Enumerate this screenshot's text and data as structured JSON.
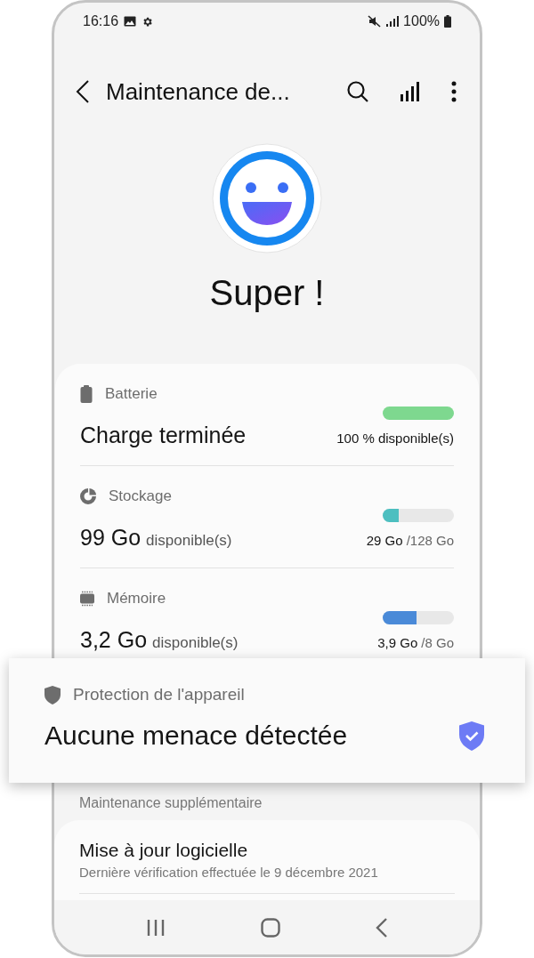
{
  "status_bar": {
    "time": "16:16",
    "battery": "100%"
  },
  "header": {
    "title": "Maintenance de..."
  },
  "status": {
    "title": "Super !"
  },
  "items": [
    {
      "label": "Batterie",
      "value": "Charge terminée",
      "level": 1.0,
      "color": "#7ed88f",
      "reading_bold": "100 % disponible(s)"
    },
    {
      "label": "Stockage",
      "value": "99 Go",
      "value_note": "disponible(s)",
      "level": 0.23,
      "color": "#4dbfc0",
      "reading_bold": "29 Go",
      "reading_rest": "/128 Go"
    },
    {
      "label": "Mémoire",
      "value": "3,2 Go",
      "value_note": "disponible(s)",
      "level": 0.48,
      "color": "#4a8ad8",
      "reading_bold": "3,9 Go",
      "reading_rest": "/8 Go"
    }
  ],
  "protection": {
    "label": "Protection de l'appareil",
    "value": "Aucune menace détectée"
  },
  "extra": {
    "heading": "Maintenance supplémentaire",
    "items": [
      {
        "title": "Mise à jour logicielle",
        "subtitle": "Dernière vérification effectuée le 9 décembre 2021"
      }
    ]
  }
}
